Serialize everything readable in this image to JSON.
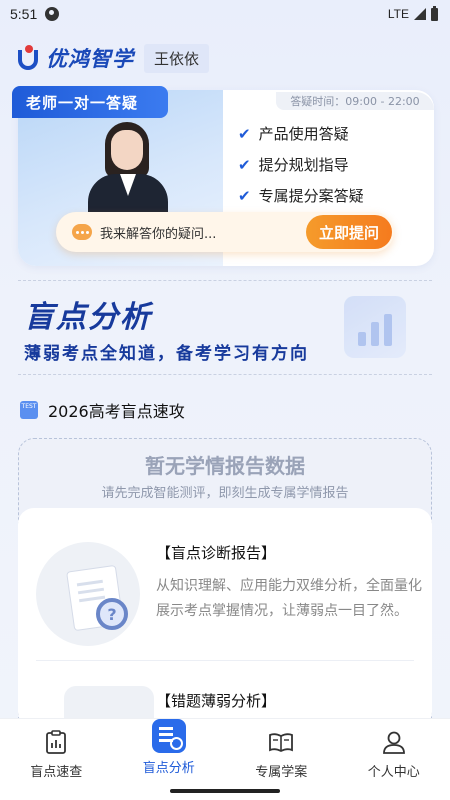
{
  "status_bar": {
    "time": "5:51",
    "network": "LTE"
  },
  "header": {
    "brand": "优鸿智学",
    "user_name": "王依依"
  },
  "teacher_card": {
    "tag": "老师一对一答疑",
    "hours": "答疑时间：09:00 - 22:00",
    "features": [
      "产品使用答疑",
      "提分规划指导",
      "专属提分案答疑"
    ],
    "ask_placeholder": "我来解答你的疑问...",
    "ask_button": "立即提问"
  },
  "blind_spot": {
    "title": "盲点分析",
    "subtitle": "薄弱考点全知道，备考学习有方向"
  },
  "section": {
    "icon_label": "TEST",
    "title": "2026高考盲点速攻",
    "empty_title": "暂无学情报告数据",
    "empty_subtitle": "请先完成智能测评，即刻生成专属学情报告"
  },
  "reports": [
    {
      "title": "【盲点诊断报告】",
      "description": "从知识理解、应用能力双维分析，全面量化展示考点掌握情况，让薄弱点一目了然。"
    },
    {
      "title": "【错题薄弱分析】"
    }
  ],
  "bottom_nav": {
    "items": [
      {
        "label": "盲点速查",
        "icon": "clipboard-chart-icon"
      },
      {
        "label": "盲点分析",
        "icon": "report-search-icon",
        "active": true
      },
      {
        "label": "专属学案",
        "icon": "open-book-icon"
      },
      {
        "label": "个人中心",
        "icon": "user-icon"
      }
    ]
  },
  "colors": {
    "primary": "#1f5bd8",
    "accent_orange": "#f57b1e",
    "brand_red": "#e23a3a"
  }
}
